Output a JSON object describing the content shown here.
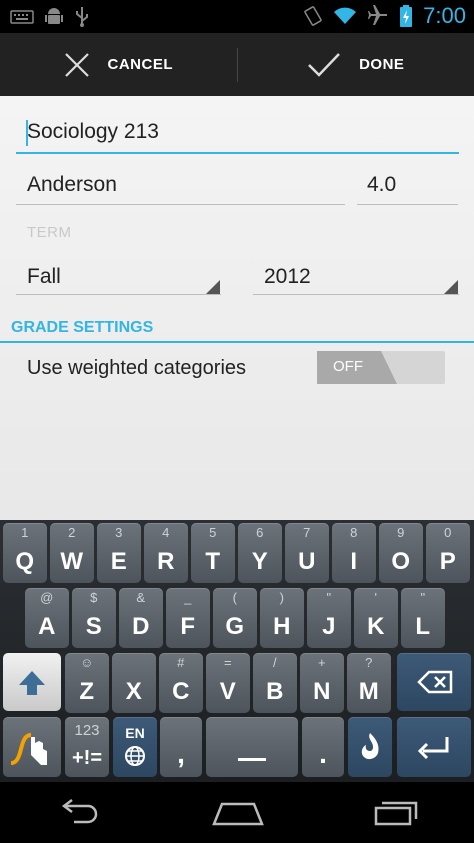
{
  "status_bar": {
    "time": "7:00"
  },
  "action_bar": {
    "cancel_label": "CANCEL",
    "done_label": "DONE"
  },
  "form": {
    "course_name": "Sociology 213",
    "instructor": "Anderson",
    "credits": "4.0",
    "term_label": "TERM",
    "term_season": "Fall",
    "term_year": "2012",
    "grade_settings_header": "GRADE SETTINGS",
    "weighted_label": "Use weighted categories",
    "weighted_switch": "OFF"
  },
  "keyboard": {
    "row1": [
      {
        "k": "Q",
        "h": "1"
      },
      {
        "k": "W",
        "h": "2"
      },
      {
        "k": "E",
        "h": "3"
      },
      {
        "k": "R",
        "h": "4"
      },
      {
        "k": "T",
        "h": "5"
      },
      {
        "k": "Y",
        "h": "6"
      },
      {
        "k": "U",
        "h": "7"
      },
      {
        "k": "I",
        "h": "8"
      },
      {
        "k": "O",
        "h": "9"
      },
      {
        "k": "P",
        "h": "0"
      }
    ],
    "row2": [
      {
        "k": "A",
        "h": "@"
      },
      {
        "k": "S",
        "h": "$"
      },
      {
        "k": "D",
        "h": "&"
      },
      {
        "k": "F",
        "h": "_"
      },
      {
        "k": "G",
        "h": "("
      },
      {
        "k": "H",
        "h": ")"
      },
      {
        "k": "J",
        "h": "\""
      },
      {
        "k": "K",
        "h": "'"
      },
      {
        "k": "L",
        "h": "\""
      }
    ],
    "row3": [
      {
        "k": "Z",
        "h": "☺"
      },
      {
        "k": "X",
        "h": ""
      },
      {
        "k": "C",
        "h": "#"
      },
      {
        "k": "V",
        "h": "="
      },
      {
        "k": "B",
        "h": "/"
      },
      {
        "k": "N",
        "h": "+"
      },
      {
        "k": "M",
        "h": "?"
      }
    ],
    "sym_key_top": "123",
    "sym_key_bottom": "+!=",
    "lang_key": "EN",
    "comma_key": ",",
    "period_key": "."
  },
  "colors": {
    "accent": "#33b5e5"
  }
}
